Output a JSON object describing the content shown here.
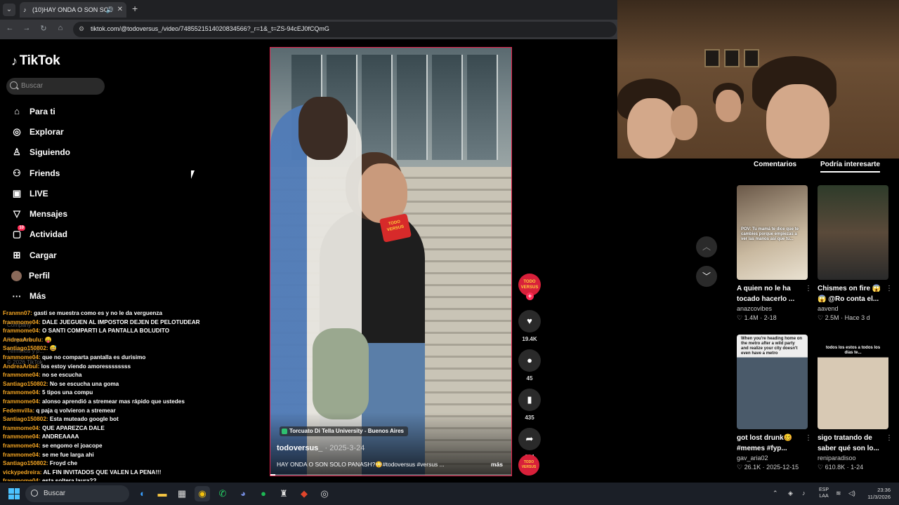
{
  "browser": {
    "tab_title": "(10)HAY ONDA O SON SOL",
    "url": "tiktok.com/@todoversus_/video/7485521514020834566?_r=1&_t=ZS-94cEJ0fCQmG"
  },
  "sidebar": {
    "logo": "TikTok",
    "search_placeholder": "Buscar",
    "items": [
      {
        "label": "Para ti",
        "icon": "home-icon"
      },
      {
        "label": "Explorar",
        "icon": "compass-icon"
      },
      {
        "label": "Siguiendo",
        "icon": "following-icon"
      },
      {
        "label": "Friends",
        "icon": "friends-icon"
      },
      {
        "label": "LIVE",
        "icon": "live-icon"
      },
      {
        "label": "Mensajes",
        "icon": "messages-icon"
      },
      {
        "label": "Actividad",
        "icon": "activity-icon",
        "badge": "10"
      },
      {
        "label": "Cargar",
        "icon": "upload-icon"
      },
      {
        "label": "Perfil",
        "icon": "profile-avatar"
      },
      {
        "label": "Más",
        "icon": "more-icon"
      }
    ],
    "footer_ghost": [
      "Company",
      "Programa",
      "Términos y p...",
      "© 2026 TikTok"
    ]
  },
  "chat": [
    {
      "user": "Franmn07:",
      "msg": "gasti se muestra como es y no le da verguenza"
    },
    {
      "user": "frammome04:",
      "msg": "DALE JUEGUEN AL IMPOSTOR DEJEN DE PELOTUDEAR"
    },
    {
      "user": "frammome04:",
      "msg": "O SANTI COMPARTI LA PANTALLA BOLUDITO"
    },
    {
      "user": "AndreaArbulu:",
      "msg": "😛"
    },
    {
      "user": "Santiago150802:",
      "msg": "😅"
    },
    {
      "user": "frammome04:",
      "msg": "que no comparta pantalla es durisimo"
    },
    {
      "user": "AndreaArbul:",
      "msg": "los estoy viendo amoressssssss"
    },
    {
      "user": "frammome04:",
      "msg": "no se escucha"
    },
    {
      "user": "Santiago150802:",
      "msg": "No se escucha una goma"
    },
    {
      "user": "frammome04:",
      "msg": "5 tipos una compu"
    },
    {
      "user": "frammome04:",
      "msg": "alonso aprendió a stremear mas rápido que ustedes"
    },
    {
      "user": "Fedemvilla:",
      "msg": "q paja q volvieron a stremear"
    },
    {
      "user": "Santiago150802:",
      "msg": "Esta muteado google bot"
    },
    {
      "user": "frammome04:",
      "msg": "QUE APAREZCA DALE"
    },
    {
      "user": "frammome04:",
      "msg": "ANDREAAAA"
    },
    {
      "user": "frammome04:",
      "msg": "se engomo el joacope"
    },
    {
      "user": "frammome04:",
      "msg": "se me fue larga ahi"
    },
    {
      "user": "Santiago150802:",
      "msg": "Froyd che"
    },
    {
      "user": "vickypedreira:",
      "msg": "AL FIN INVITADOS QUE VALEN LA PENA!!!"
    },
    {
      "user": "frammome04:",
      "msg": "esta soltera laura??"
    }
  ],
  "video": {
    "location": "Torcuato Di Tella University - Buenos Aires",
    "author": "todoversus_",
    "date": "· 2025-3-24",
    "caption": "HAY ONDA O SON SOLO PANASH?😳#todoversus #versus ...",
    "more": "más",
    "mic_label": "TODO VERSUS",
    "progress": 0.02
  },
  "actions": {
    "likes": "19.4K",
    "comments": "45",
    "saves": "435",
    "shares": "824"
  },
  "panel": {
    "tab_comments": "Comentarios",
    "tab_suggestions": "Podría interesarte",
    "cards": [
      {
        "title": "A quien no le ha tocado hacerlo ...",
        "author": "anazcovibes",
        "likes": "1.4M",
        "date": "2-18",
        "overlay": "POV: Tu mamá te dice que te cambies porque empiezas a ver las manos así que tú..."
      },
      {
        "title": "Chismes on fire 😱😱 @Ro conta el...",
        "author": "aavend",
        "likes": "2.5M",
        "date": "Hace 3 d",
        "overlay": ""
      },
      {
        "title": "got lost drunk🥴 #memes #fyp...",
        "author": "gav_aria02",
        "likes": "26.1K",
        "date": "2025-12-15",
        "overlay": "When you're heading home on the metro after a wild party and realize your city doesn't even have a metro"
      },
      {
        "title": "sigo tratando de saber qué son lo...",
        "author": "reniparadisoo",
        "likes": "610.8K",
        "date": "1-24",
        "overlay": "todos los estos a todos los días te..."
      }
    ]
  },
  "taskbar": {
    "search": "Buscar",
    "lang": "ESP",
    "lang2": "LAA",
    "time": "23:36",
    "date": "11/3/2026"
  }
}
